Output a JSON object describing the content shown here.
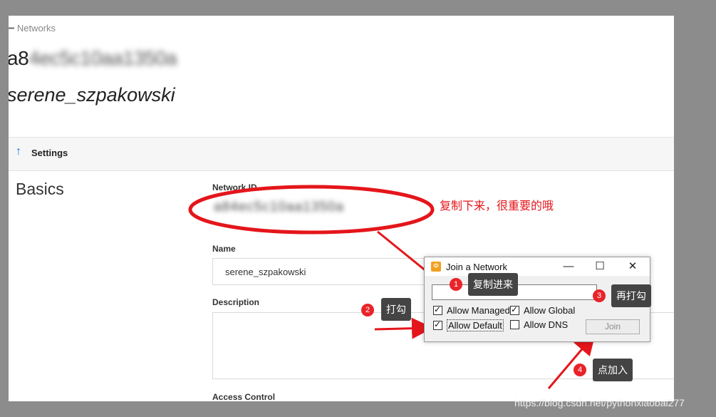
{
  "breadcrumb": {
    "label": "Networks"
  },
  "network": {
    "id_title": "a8",
    "id_title_obscured": "4ec5c10aa1350a",
    "name_title": "serene_szpakowski"
  },
  "settings": {
    "label": "Settings"
  },
  "section": {
    "title": "Basics"
  },
  "form": {
    "network_id_label": "Network ID",
    "network_id_value": "a84ec5c10aa1350a",
    "name_label": "Name",
    "name_value": "serene_szpakowski",
    "description_label": "Description",
    "access_control_label": "Access Control"
  },
  "annotation_main": "复制下来，很重要的哦",
  "dialog": {
    "title": "Join a Network",
    "minimize": "—",
    "maximize": "☐",
    "close": "✕",
    "allow_managed": "Allow Managed",
    "allow_global": "Allow Global",
    "allow_default": "Allow Default",
    "allow_dns": "Allow DNS",
    "join": "Join"
  },
  "steps": [
    {
      "num": "1",
      "text": "复制进来"
    },
    {
      "num": "2",
      "text": "打勾"
    },
    {
      "num": "3",
      "text": "再打勾"
    },
    {
      "num": "4",
      "text": "点加入"
    }
  ],
  "watermark": "https://blog.csdn.net/pythonxiaobai277",
  "colors": {
    "annotation_red": "#e4161b",
    "tip_bg": "#444444",
    "accent_blue": "#1a73e8"
  }
}
